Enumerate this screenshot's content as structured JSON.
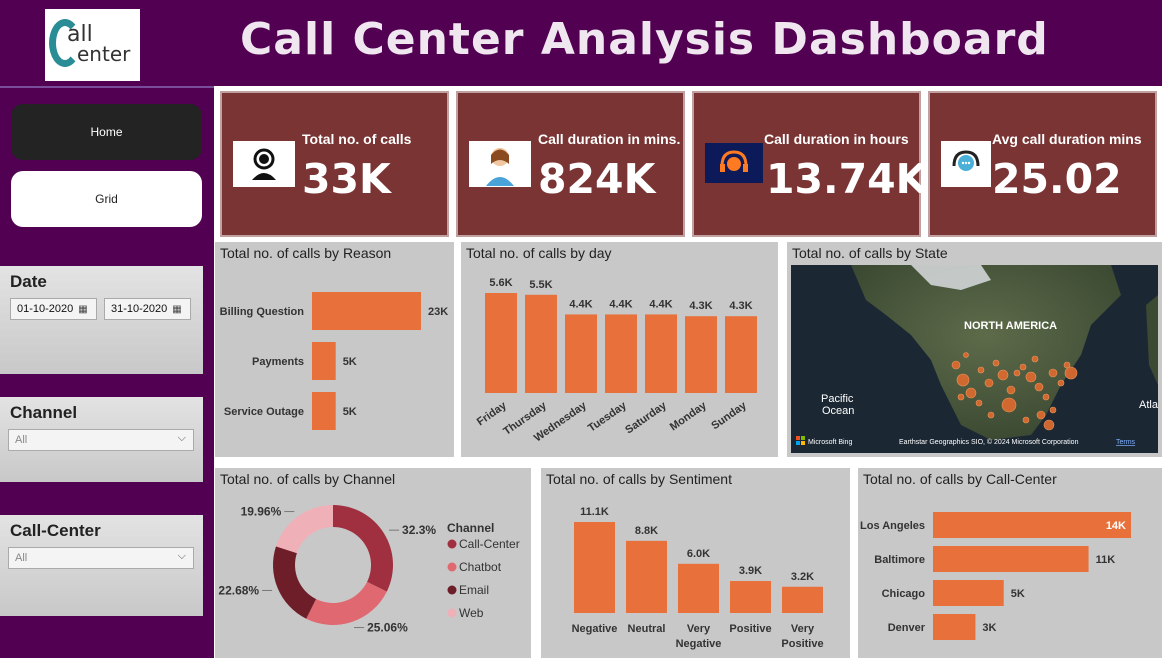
{
  "header": {
    "title": "Call Center Analysis Dashboard",
    "logo_line1": "all",
    "logo_line2": "enter"
  },
  "nav": {
    "home": "Home",
    "grid": "Grid"
  },
  "slicers": {
    "date": {
      "label": "Date",
      "start": "01-10-2020",
      "end": "31-10-2020"
    },
    "channel": {
      "label": "Channel",
      "value": "All"
    },
    "call_center": {
      "label": "Call-Center",
      "value": "All"
    }
  },
  "kpis": [
    {
      "title": "Total no. of calls",
      "value": "33K",
      "icon": "agent-icon"
    },
    {
      "title": "Call duration in mins.",
      "value": "824K",
      "icon": "operator-icon"
    },
    {
      "title": "Call duration in hours",
      "value": "13.74K",
      "icon": "headset-icon"
    },
    {
      "title": "Avg call duration mins",
      "value": "25.02",
      "icon": "call-center-icon"
    }
  ],
  "map": {
    "title": "Total no. of calls by State",
    "region_label": "NORTH AMERICA",
    "ocean_label_1": "Pacific",
    "ocean_label_2": "Ocean",
    "edge_label": "Atla",
    "brand": "Microsoft Bing",
    "attribution": "Earthstar Geographics SIO, © 2024 Microsoft Corporation",
    "terms": "Terms"
  },
  "chart_data": [
    {
      "type": "bar",
      "orientation": "horizontal",
      "title": "Total no. of calls by Reason",
      "categories": [
        "Billing Question",
        "Payments",
        "Service Outage"
      ],
      "values": [
        23,
        5,
        5
      ],
      "labels": [
        "23K",
        "5K",
        "5K"
      ],
      "color": "#e8703a"
    },
    {
      "type": "bar",
      "title": "Total no. of calls by day",
      "categories": [
        "Friday",
        "Thursday",
        "Wednesday",
        "Tuesday",
        "Saturday",
        "Monday",
        "Sunday"
      ],
      "values": [
        5.6,
        5.5,
        4.4,
        4.4,
        4.4,
        4.3,
        4.3
      ],
      "labels": [
        "5.6K",
        "5.5K",
        "4.4K",
        "4.4K",
        "4.4K",
        "4.3K",
        "4.3K"
      ],
      "color": "#e8703a"
    },
    {
      "type": "pie",
      "donut": true,
      "title": "Total no. of calls by Channel",
      "legend_title": "Channel",
      "categories": [
        "Call-Center",
        "Chatbot",
        "Email",
        "Web"
      ],
      "values": [
        32.3,
        25.06,
        22.68,
        19.96
      ],
      "labels": [
        "32.3%",
        "25.06%",
        "22.68%",
        "19.96%"
      ],
      "colors": [
        "#a03040",
        "#e06870",
        "#6e1e28",
        "#f0b0b8"
      ]
    },
    {
      "type": "bar",
      "title": "Total no. of calls by Sentiment",
      "categories": [
        "Negative",
        "Neutral",
        "Very Negative",
        "Positive",
        "Very Positive"
      ],
      "values": [
        11.1,
        8.8,
        6.0,
        3.9,
        3.2
      ],
      "labels": [
        "11.1K",
        "8.8K",
        "6.0K",
        "3.9K",
        "3.2K"
      ],
      "color": "#e8703a"
    },
    {
      "type": "bar",
      "orientation": "horizontal",
      "title": "Total no. of calls by Call-Center",
      "categories": [
        "Los Angeles",
        "Baltimore",
        "Chicago",
        "Denver"
      ],
      "values": [
        14,
        11,
        5,
        3
      ],
      "labels": [
        "14K",
        "11K",
        "5K",
        "3K"
      ],
      "color": "#e8703a"
    }
  ]
}
